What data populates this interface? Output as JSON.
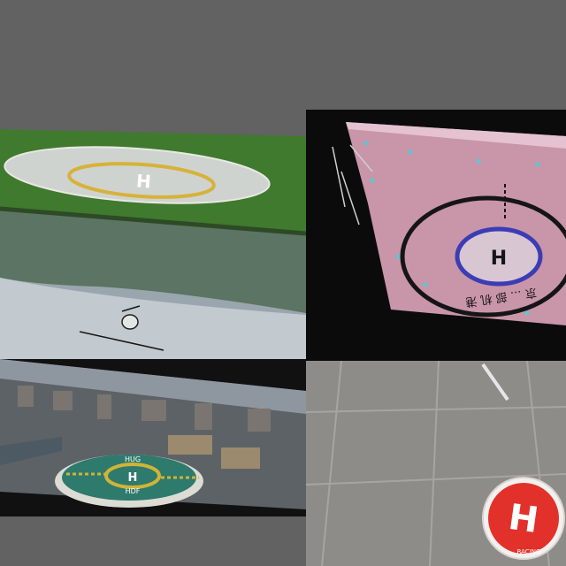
{
  "canvas_bg": "#626262",
  "panels": [
    {
      "id": "lakeside-helipad-photo",
      "helipad_letter": "H",
      "colors": {
        "grass": "#3f7a2e",
        "water": "#9aa6ad",
        "ring": "#d7b23a"
      }
    },
    {
      "id": "pink-rooftop-helipad-photo",
      "helipad_letter": "H",
      "pad_text": "京 ... 部 机 港",
      "colors": {
        "deck": "#c995a8",
        "circle": "#151515",
        "inner_ring": "#3c3cb5"
      }
    },
    {
      "id": "city-rooftop-helipad-photo",
      "helipad_letter": "H",
      "pad_text_top": "HUG",
      "pad_text_bottom": "HDF",
      "colors": {
        "pad": "#2e7a6c",
        "ring": "#d0b437",
        "sky": "#8e97a0"
      }
    },
    {
      "id": "landing-pad-mat-photo",
      "helipad_letter": "H",
      "mat_text": "RACING",
      "colors": {
        "floor": "#8d8c88",
        "mat": "#e2312b"
      }
    }
  ]
}
